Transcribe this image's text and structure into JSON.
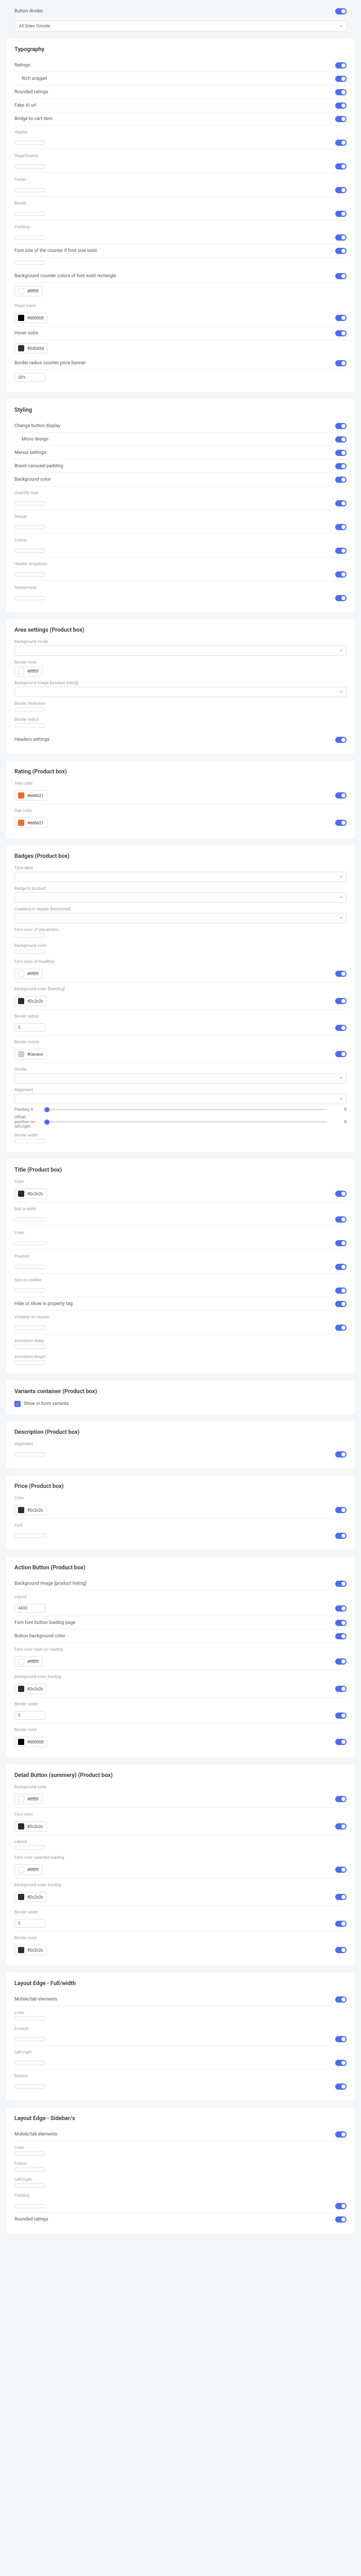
{
  "preSection": {
    "label1": "Button divider",
    "selectLabel": "All Sides Outside",
    "selectValue": ""
  },
  "sections": {
    "typo": {
      "title": "Typography",
      "rows": [
        {
          "label": "Ratings",
          "toggle": true,
          "sub": false
        },
        {
          "label": "Rich snippet",
          "toggle": true,
          "sub": true
        },
        {
          "label": "Rounded ratings",
          "toggle": true,
          "sub": false
        },
        {
          "label": "Fake AI url",
          "toggle": true,
          "sub": false
        },
        {
          "label": "Bridge to cart item",
          "toggle": true,
          "sub": false
        }
      ],
      "fields": [
        {
          "label": "Header",
          "type": "input",
          "value": ""
        },
        {
          "label": "Departments",
          "type": "input",
          "value": ""
        },
        {
          "label": "Footer",
          "type": "input",
          "value": ""
        },
        {
          "label": "Border",
          "type": "input",
          "value": ""
        },
        {
          "label": "Padding",
          "type": "input",
          "value": ""
        }
      ],
      "textRows": [
        {
          "label": "Font size of the counter if font size exist",
          "place": "",
          "toggle": true
        },
        {
          "label": "Background counter colors of font exist rectangle",
          "color": "#ffffff",
          "colorName": "#ffffff",
          "toggle": true
        }
      ],
      "shareIcons": {
        "label": "Share icons",
        "value": "#000000",
        "toggle": true
      },
      "hoverColor": {
        "label": "Hover color",
        "value": "#2d2d2d",
        "toggle": true
      },
      "borderRadius": {
        "label": "Border radius counter price banner",
        "value": "20%",
        "toggle": true
      }
    },
    "styling": {
      "title": "Styling",
      "rows": [
        {
          "label": "Change button display",
          "toggle": true
        },
        {
          "label": "Micro design",
          "toggle": true,
          "sub": true
        },
        {
          "label": "Menus settings",
          "toggle": true
        },
        {
          "label": "Brand carousel padding",
          "toggle": true
        },
        {
          "label": "Background color",
          "toggle": true
        }
      ],
      "fields": [
        {
          "label": "Quantity tags",
          "value": ""
        },
        {
          "label": "Design",
          "value": ""
        },
        {
          "label": "Follow",
          "value": ""
        },
        {
          "label": "Header dropdown",
          "value": ""
        },
        {
          "label": "Anonymous",
          "value": ""
        }
      ]
    },
    "area": {
      "title": "Area settings (Product box)",
      "bgMode": {
        "label": "Background mode",
        "value": ""
      },
      "border": {
        "label": "Border color",
        "value": "#ffffff"
      },
      "bgImg": {
        "label": "Background image [product listing]",
        "value": ""
      },
      "borderOp": {
        "label": "Border thickness",
        "value": ""
      },
      "bNum": {
        "label": "Border radius",
        "value": ""
      },
      "headers": {
        "label": "Headers settings",
        "toggle": true
      }
    },
    "rating": {
      "title": "Rating (Product box)",
      "txtColor": {
        "label": "Text color",
        "value": "#ed6b21",
        "toggle": true
      },
      "starColor": {
        "label": "Star color",
        "value": "#ed6b21",
        "toggle": true
      }
    },
    "badges": {
      "title": "Badges (Product box)",
      "typeLabel": {
        "label": "Type label",
        "value": "",
        "placeholder": ""
      },
      "rows": [
        {
          "label": "Badge to product",
          "value": ""
        },
        {
          "label": "Coalesce in header [horizontal]",
          "value": ""
        },
        {
          "label": "Font color of placement",
          "value": ""
        },
        {
          "label": "Background color",
          "value": ""
        }
      ],
      "fontColor": {
        "label": "Font color of headline",
        "value": "#ffffff",
        "toggle": true
      },
      "bgColor": {
        "label": "Background color [heading]",
        "value": "#2c2c2c",
        "toggle": true
      },
      "borderRadius": {
        "label": "Border radius",
        "value": "0",
        "toggle": true
      },
      "borderColor": {
        "label": "Border colors",
        "value": "#cecece",
        "toggle": true
      },
      "divider": {
        "label": "Divider",
        "value": ""
      },
      "alignment": {
        "label": "Alignment",
        "value": ""
      },
      "sliders": [
        {
          "label": "Padding X",
          "value": "0"
        },
        {
          "label": "Offset position on left/right",
          "value": "0"
        }
      ],
      "borderWidth": {
        "label": "Border width",
        "value": ""
      }
    },
    "titleBox": {
      "title": "Title (Product box)",
      "color": {
        "label": "Color",
        "value": "#2c2c2c",
        "toggle": true
      },
      "rows": [
        {
          "label": "Add a width",
          "value": ""
        },
        {
          "label": "Lines",
          "value": ""
        },
        {
          "label": "Position",
          "value": ""
        },
        {
          "label": "Size on mobile",
          "value": ""
        },
        {
          "label": "Hide or show in property tag",
          "toggle": true
        },
        {
          "label": "Visibility on mobile",
          "value": ""
        },
        {
          "label": "Animation delay",
          "value": ""
        },
        {
          "label": "Animation length",
          "value": ""
        }
      ]
    },
    "variants": {
      "title": "Variants container (Product box)",
      "check": {
        "label": "Show in form variants"
      }
    },
    "description": {
      "title": "Description (Product box)",
      "align": {
        "label": "Alignment",
        "value": "",
        "toggle": true
      }
    },
    "price": {
      "title": "Price (Product box)",
      "color": {
        "label": "Color",
        "value": "#2c2c2c",
        "toggle": true
      },
      "font": {
        "label": "Font",
        "value": "",
        "toggle": true
      }
    },
    "action": {
      "title": "Action Button (Product box)",
      "header": {
        "label": "Background image [product listing]",
        "toggle": true
      },
      "rows": [
        {
          "label": "Layout",
          "value": "4400"
        },
        {
          "label": "Font font button loading page",
          "toggle": true
        },
        {
          "label": "Button background color",
          "toggle": true
        }
      ],
      "fontColor": {
        "label": "Font color each on loading",
        "value": "#ffffff",
        "toggle": true
      },
      "bgLoad": {
        "label": "Background color loading",
        "value": "#2c2c2c",
        "toggle": true
      },
      "borderWidth": {
        "label": "Border width",
        "value": "0",
        "toggle": true
      },
      "borderColor": {
        "label": "Border color",
        "value": "#000000",
        "toggle": true
      }
    },
    "detail": {
      "title": "Detail Button (summery) (Product box)",
      "rows": [
        {
          "label": "Background color",
          "value": "#ffffff",
          "toggle": true
        },
        {
          "label": "Font color",
          "value": "#2c2c2c",
          "toggle": true
        },
        {
          "label": "Layout",
          "value": ""
        }
      ],
      "fontLoad": {
        "label": "Font color selected loading",
        "value": "#ffffff",
        "toggle": true
      },
      "bgLoad": {
        "label": "Background color loading",
        "value": "#2c2c2c",
        "toggle": true
      },
      "borderW": {
        "label": "Border width",
        "value": "0",
        "toggle": true
      },
      "borderC": {
        "label": "Border color",
        "value": "#2c2c2c",
        "toggle": true
      }
    },
    "edge1": {
      "title": "Layout Edge - Full/width",
      "rows": [
        {
          "label": "Mobile/tab elements",
          "toggle": true
        },
        {
          "label": "Lines",
          "value": ""
        },
        {
          "label": "Excerpt",
          "value": "",
          "toggle": true
        },
        {
          "label": "Left/right",
          "value": "",
          "toggle": true
        },
        {
          "label": "Bottom",
          "value": "",
          "toggle": true
        }
      ]
    },
    "edge2": {
      "title": "Layout Edge - Sidebar/s",
      "rows": [
        {
          "label": "Mobile/tab elements",
          "toggle": true
        },
        {
          "label": "Lines",
          "value": ""
        },
        {
          "label": "Follow",
          "value": ""
        },
        {
          "label": "Left/right",
          "value": ""
        },
        {
          "label": "Padding",
          "value": "",
          "toggle": true
        },
        {
          "label": "Rounded ratings",
          "toggle": true
        }
      ]
    }
  }
}
